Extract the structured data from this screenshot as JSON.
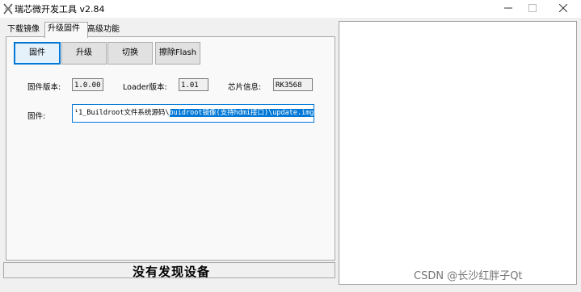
{
  "window": {
    "title": "瑞芯微开发工具 v2.84",
    "controls": {
      "minimize": "—",
      "maximize": "☐",
      "close": "✕"
    }
  },
  "tabs": [
    {
      "label": "下载镜像",
      "active": false
    },
    {
      "label": "升级固件",
      "active": true
    },
    {
      "label": "高级功能",
      "active": false
    }
  ],
  "toolbar": {
    "firmware_label": "固件",
    "upgrade_label": "升级",
    "switch_label": "切换",
    "erase_label": "擦除Flash"
  },
  "info": {
    "firmware_version_label": "固件版本:",
    "firmware_version_value": "1.0.00",
    "loader_version_label": "Loader版本:",
    "loader_version_value": "1.01",
    "chip_info_label": "芯片信息:",
    "chip_info_value": "RK3568"
  },
  "firmware_path": {
    "label": "固件:",
    "value_plain": "¹1_Buildroot文件系统源码\\",
    "value_selected": "buidroot镜像(支持hdmi接口)\\update.img"
  },
  "status": {
    "text": "没有发现设备"
  },
  "watermark": {
    "text": "CSDN @长沙红胖子Qt"
  },
  "icons": {
    "app": "rockchip-tool-icon",
    "minimize": "minimize-icon",
    "maximize": "maximize-icon",
    "close": "close-icon"
  },
  "colors": {
    "accent": "#0078d7",
    "selection_text": "#ffffff",
    "window_bg": "#f0f0f0"
  }
}
